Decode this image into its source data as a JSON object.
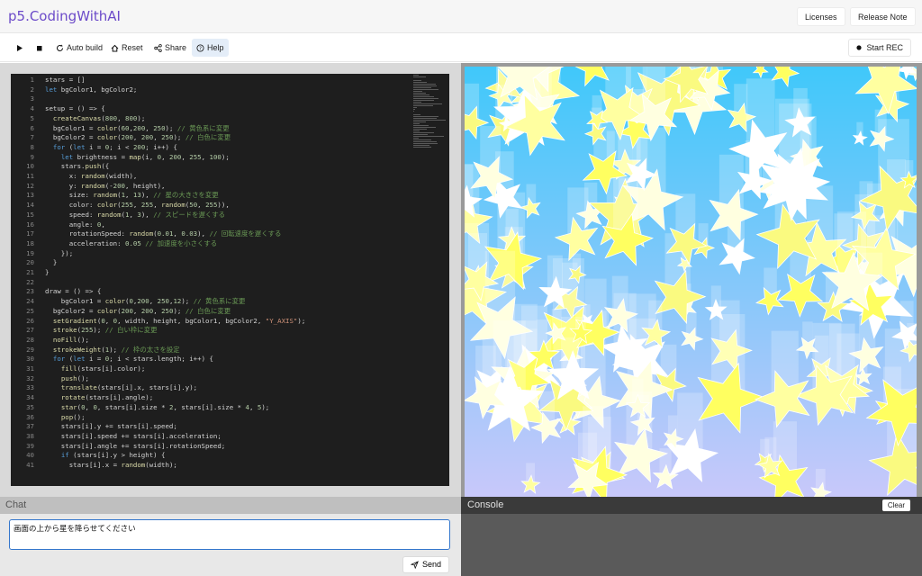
{
  "app": {
    "title": "p5.CodingWithAI"
  },
  "header": {
    "licenses_label": "Licenses",
    "release_note_label": "Release Note"
  },
  "toolbar": {
    "auto_build_label": "Auto build",
    "reset_label": "Reset",
    "share_label": "Share",
    "help_label": "Help",
    "start_rec_label": "Start REC",
    "accent_color": "#e4edf8"
  },
  "editor": {
    "lines": [
      "stars = []",
      "let bgColor1, bgColor2;",
      "",
      "setup = () => {",
      "  createCanvas(800, 800);",
      "  bgColor1 = color(60,200, 250); // 黄色系に変更",
      "  bgColor2 = color(200, 200, 250); // 白色に変更",
      "  for (let i = 0; i < 200; i++) {",
      "    let brightness = map(i, 0, 200, 255, 100);",
      "    stars.push({",
      "      x: random(width),",
      "      y: random(-200, height),",
      "      size: random(1, 13), // 星の大きさを変更",
      "      color: color(255, 255, random(50, 255)),",
      "      speed: random(1, 3), // スピードを遅くする",
      "      angle: 0,",
      "      rotationSpeed: random(0.01, 0.03), // 回転速度を遅くする",
      "      acceleration: 0.05 // 加速度を小さくする",
      "    });",
      "  }",
      "}",
      "",
      "draw = () => {",
      "    bgColor1 = color(0,200, 250,12); // 黄色系に変更",
      "  bgColor2 = color(200, 200, 250); // 白色に変更",
      "  setGradient(0, 0, width, height, bgColor1, bgColor2, \"Y_AXIS\");",
      "  stroke(255); // 白い枠に変更",
      "  noFill();",
      "  strokeWeight(1); // 枠の太さを設定",
      "  for (let i = 0; i < stars.length; i++) {",
      "    fill(stars[i].color);",
      "    push();",
      "    translate(stars[i].x, stars[i].y);",
      "    rotate(stars[i].angle);",
      "    star(0, 0, stars[i].size * 2, stars[i].size * 4, 5);",
      "    pop();",
      "    stars[i].y += stars[i].speed;",
      "    stars[i].speed += stars[i].acceleration;",
      "    stars[i].angle += stars[i].rotationSpeed;",
      "    if (stars[i].y > height) {",
      "      stars[i].x = random(width);"
    ]
  },
  "canvas": {
    "gradient_top": "#40c8fa",
    "gradient_bottom": "#c8c8fa",
    "star_colors": [
      "#ffffa0",
      "#ffff60",
      "#ffffe0",
      "#fafa80",
      "#ffffff"
    ]
  },
  "chat": {
    "title": "Chat",
    "input_value": "画面の上から星を降らせてください",
    "send_label": "Send"
  },
  "console": {
    "title": "Console",
    "clear_label": "Clear"
  }
}
